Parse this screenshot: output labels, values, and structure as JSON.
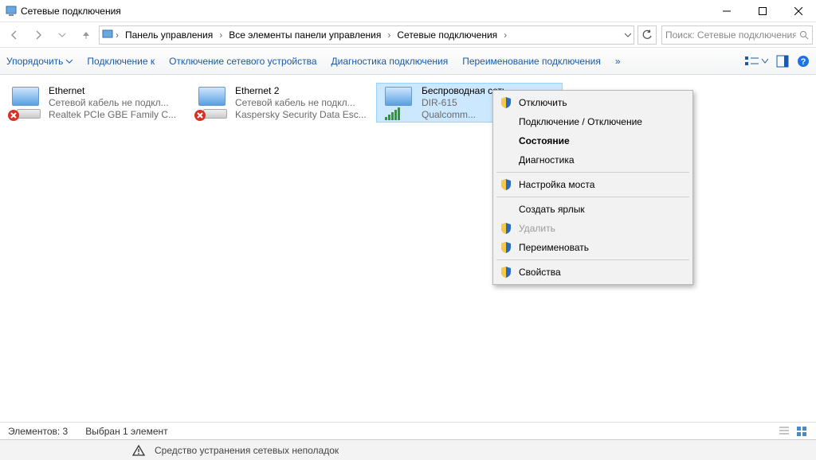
{
  "window": {
    "title": "Сетевые подключения"
  },
  "breadcrumbs": {
    "b1": "Панель управления",
    "b2": "Все элементы панели управления",
    "b3": "Сетевые подключения"
  },
  "search": {
    "placeholder": "Поиск: Сетевые подключения"
  },
  "toolbar": {
    "organize": "Упорядочить",
    "connect": "Подключение к",
    "disable": "Отключение сетевого устройства",
    "diagnose": "Диагностика подключения",
    "rename": "Переименование подключения",
    "more": "»"
  },
  "adapters": {
    "a1": {
      "name": "Ethernet",
      "status": "Сетевой кабель не подкл...",
      "device": "Realtek PCIe GBE Family C..."
    },
    "a2": {
      "name": "Ethernet 2",
      "status": "Сетевой кабель не подкл...",
      "device": "Kaspersky Security Data Esc..."
    },
    "a3": {
      "name": "Беспроводная сеть",
      "status": "DIR-615",
      "device": "Qualcomm..."
    }
  },
  "context_menu": {
    "m1": "Отключить",
    "m2": "Подключение / Отключение",
    "m3": "Состояние",
    "m4": "Диагностика",
    "m5": "Настройка моста",
    "m6": "Создать ярлык",
    "m7": "Удалить",
    "m8": "Переименовать",
    "m9": "Свойства"
  },
  "statusbar": {
    "count": "Элементов: 3",
    "selected": "Выбран 1 элемент"
  },
  "bottombar": {
    "text": "Средство устранения сетевых неполадок"
  }
}
